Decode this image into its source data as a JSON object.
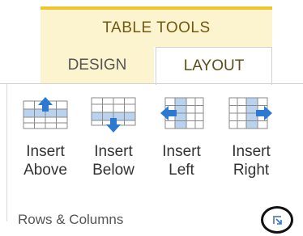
{
  "context": {
    "title": "TABLE TOOLS"
  },
  "tabs": [
    {
      "label": "DESIGN",
      "selected": false
    },
    {
      "label": "LAYOUT",
      "selected": true
    }
  ],
  "group": {
    "label": "Rows & Columns",
    "buttons": [
      {
        "line1": "Insert",
        "line2": "Above",
        "icon": "insert-above-icon"
      },
      {
        "line1": "Insert",
        "line2": "Below",
        "icon": "insert-below-icon"
      },
      {
        "line1": "Insert",
        "line2": "Left",
        "icon": "insert-left-icon"
      },
      {
        "line1": "Insert",
        "line2": "Right",
        "icon": "insert-right-icon"
      }
    ],
    "launcher_icon": "dialog-launcher-icon"
  },
  "colors": {
    "accent_yellow": "#f0c42a",
    "context_bg": "#fcf4cf",
    "arrow_blue": "#2b79d0",
    "highlight_blue": "#b9d3ef"
  }
}
